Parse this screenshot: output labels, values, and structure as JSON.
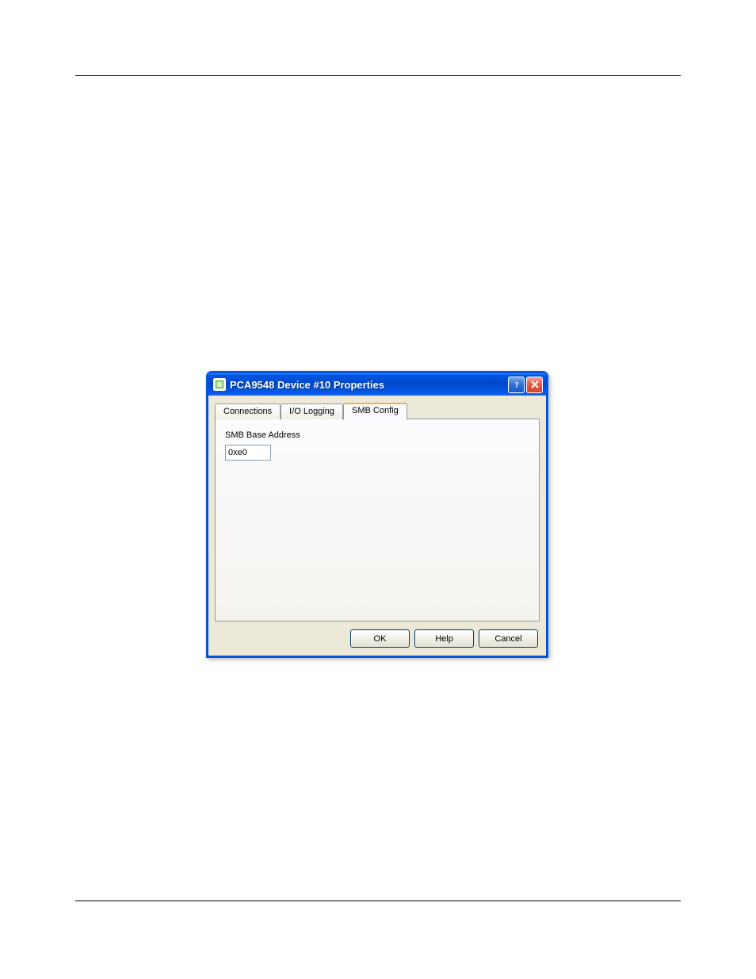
{
  "dialog": {
    "title": "PCA9548 Device #10 Properties",
    "tabs": [
      {
        "label": "Connections"
      },
      {
        "label": "I/O Logging"
      },
      {
        "label": "SMB Config"
      }
    ],
    "active_tab_index": 2,
    "smb_config": {
      "label": "SMB Base Address",
      "value": "0xe0"
    },
    "buttons": {
      "ok": "OK",
      "help": "Help",
      "cancel": "Cancel"
    }
  }
}
